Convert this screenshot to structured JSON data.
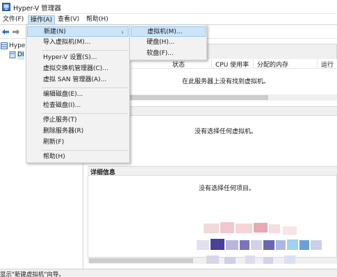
{
  "window": {
    "title": "Hyper-V 管理器"
  },
  "menubar": {
    "items": [
      {
        "label": "文件(F)"
      },
      {
        "label": "操作(A)"
      },
      {
        "label": "查看(V)"
      },
      {
        "label": "帮助(H)"
      }
    ],
    "active_index": 1
  },
  "tree": {
    "items": [
      {
        "label": "Hyper"
      },
      {
        "label": "DI"
      }
    ],
    "selected_index": 1
  },
  "vm_table": {
    "columns": [
      "状态",
      "CPU 使用率",
      "分配的内存",
      "运行"
    ],
    "empty_message": "在此服务器上没有找到虚拟机。"
  },
  "checkpoints": {
    "empty_message": "没有选择任何虚拟机。"
  },
  "details": {
    "title": "详细信息",
    "empty_message": "没有选择任何项目。"
  },
  "action_menu": {
    "items": [
      {
        "label": "新建(N)",
        "has_submenu": true
      },
      {
        "label": "导入虚拟机(M)..."
      },
      {
        "label": "Hyper-V 设置(S)..."
      },
      {
        "label": "虚拟交换机管理器(C)..."
      },
      {
        "label": "虚拟 SAN 管理器(A)..."
      },
      {
        "label": "编辑磁盘(E)..."
      },
      {
        "label": "检查磁盘(I)..."
      },
      {
        "label": "停止服务(T)"
      },
      {
        "label": "删除服务器(R)"
      },
      {
        "label": "刷新(F)"
      },
      {
        "label": "帮助(H)"
      }
    ],
    "highlighted_index": 0
  },
  "new_submenu": {
    "items": [
      {
        "label": "虚拟机(M)..."
      },
      {
        "label": "硬盘(H)..."
      },
      {
        "label": "软盘(F)..."
      }
    ],
    "highlighted_index": 0
  },
  "statusbar": {
    "text": "显示\"新建虚拟机\"向导。"
  },
  "colors": {
    "menu_highlight": "#cce4f7",
    "menu_highlight_border": "#99c9ef",
    "menu_background": "#f2f2f2",
    "pane_header": "#f0f0f0"
  },
  "icons": {
    "app": "hyper-v-icon",
    "back": "back-arrow-icon",
    "forward": "forward-arrow-icon",
    "server": "server-icon",
    "submenu": "chevron-right-icon"
  }
}
